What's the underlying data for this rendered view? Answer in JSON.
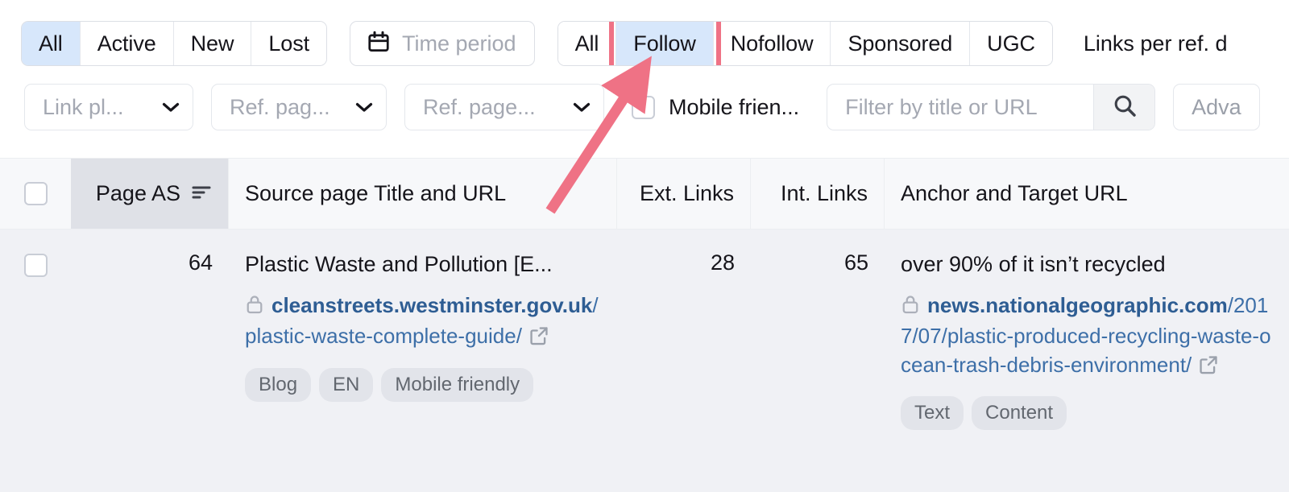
{
  "filters": {
    "status_group": {
      "options": [
        "All",
        "Active",
        "New",
        "Lost"
      ],
      "selected": "All"
    },
    "time_period": {
      "icon": "calendar-icon",
      "placeholder": "Time period"
    },
    "follow_group": {
      "options": [
        "All",
        "Follow",
        "Nofollow",
        "Sponsored",
        "UGC"
      ],
      "selected": "Follow",
      "highlight_color": "#ef7285",
      "selected_bg": "#d7e7fb"
    },
    "links_per_ref": "Links per ref. d",
    "link_placement": "Link pl...",
    "ref_page_1": "Ref. pag...",
    "ref_page_2": "Ref. page...",
    "mobile_friendly": {
      "label": "Mobile frien...",
      "checked": false
    },
    "search": {
      "placeholder": "Filter by title or URL",
      "value": "",
      "icon": "search-icon"
    },
    "advanced": "Adva"
  },
  "table": {
    "headers": {
      "select_all": "",
      "page_as": "Page AS",
      "source_page": "Source page Title and URL",
      "ext_links": "Ext. Links",
      "int_links": "Int. Links",
      "anchor_target": "Anchor and Target URL"
    },
    "sorted_column": "Page AS",
    "sort_icon": "sort-descending-icon",
    "rows": [
      {
        "page_as": "64",
        "source_title": "Plastic Waste and Pollution [E...",
        "source_url_domain": "cleanstreets.westminster.g",
        "source_url_domain_2": "ov.uk",
        "source_url_path": "/plastic-waste-complete-guide/",
        "source_lock_icon": "lock-icon",
        "source_external_icon": "external-link-icon",
        "source_tags": [
          "Blog",
          "EN",
          "Mobile friendly"
        ],
        "ext_links": "28",
        "int_links": "65",
        "anchor_text": "over 90% of it isn’t recycled",
        "target_url_domain": "news.nationalgeographic.c",
        "target_url_domain_2": "om",
        "target_url_path": "/2017/07/plastic-produced-recycling-waste-ocean-trash-debris-environment/",
        "target_lock_icon": "lock-icon",
        "target_external_icon": "external-link-icon",
        "target_tags": [
          "Text",
          "Content"
        ]
      }
    ]
  },
  "annotation": {
    "type": "arrow",
    "color": "#ef7285",
    "points_to": "Follow"
  }
}
